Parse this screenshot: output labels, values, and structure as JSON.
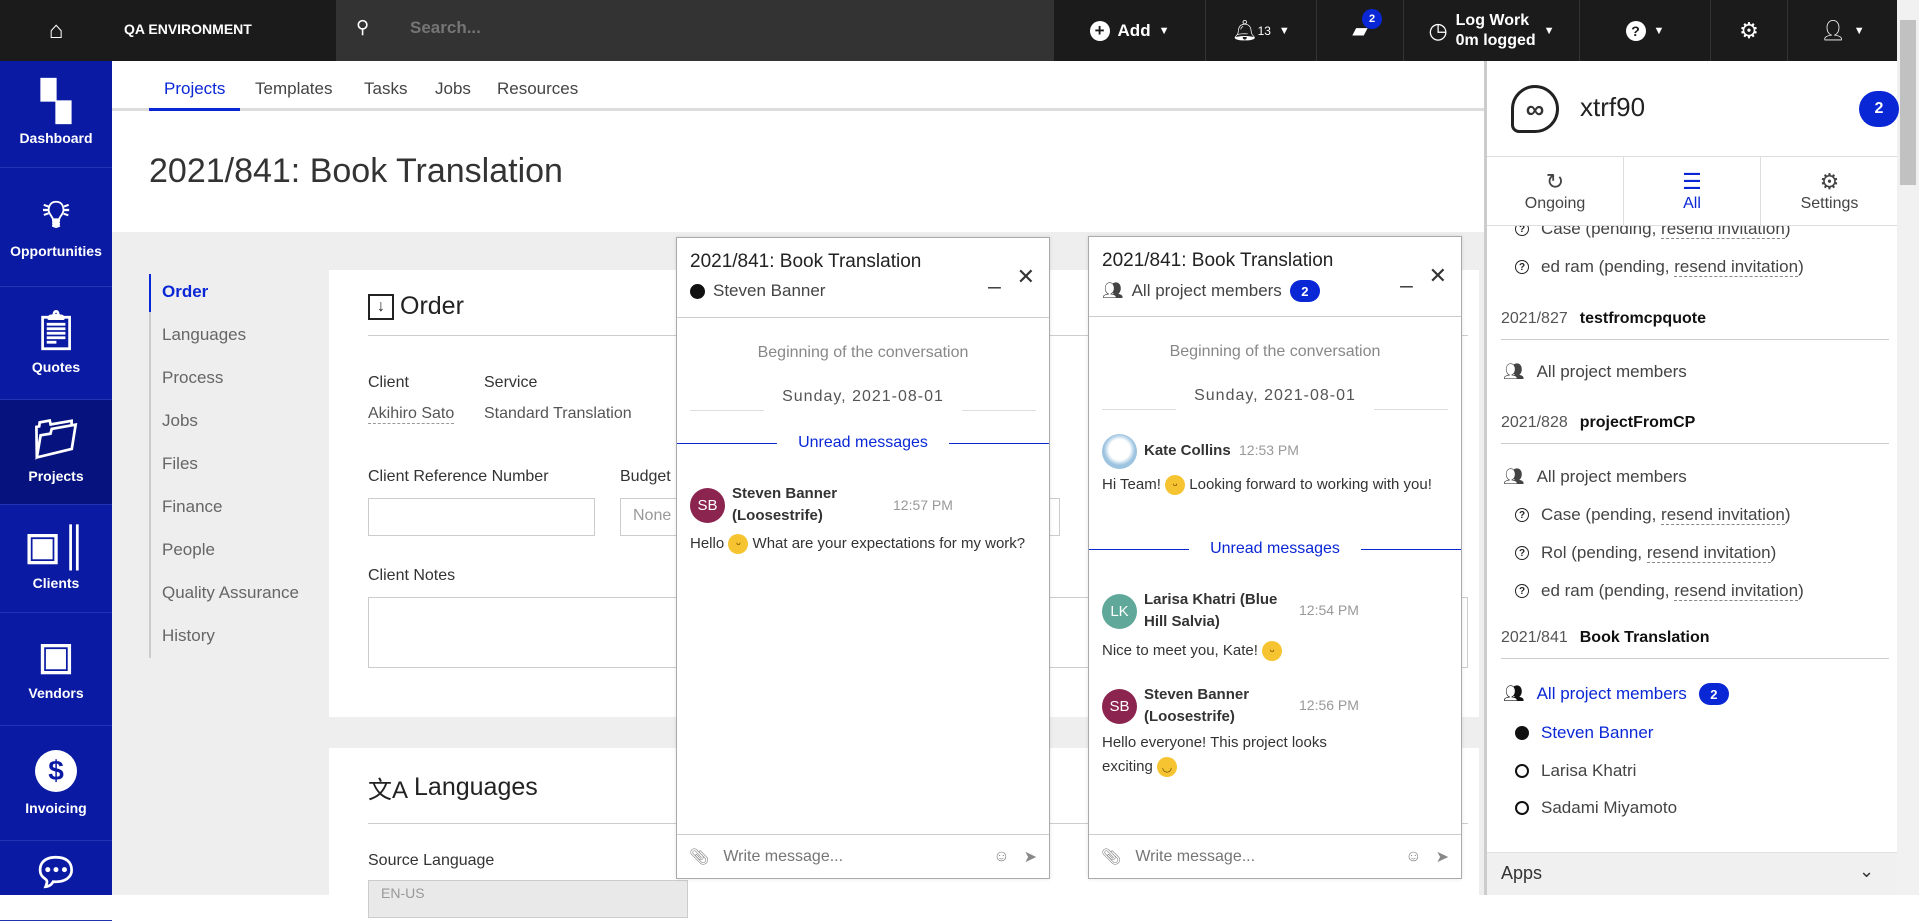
{
  "topbar": {
    "environment": "QA ENVIRONMENT",
    "search_placeholder": "Search...",
    "add_label": "Add",
    "notifications_count": "13",
    "messages_count": "2",
    "log_work_title": "Log Work",
    "log_work_value": "0m logged"
  },
  "sidebar": {
    "items": [
      {
        "label": "Dashboard",
        "icon": "dashboard-icon"
      },
      {
        "label": "Opportunities",
        "icon": "lightbulb-icon"
      },
      {
        "label": "Quotes",
        "icon": "clipboard-icon"
      },
      {
        "label": "Projects",
        "icon": "folder-icon",
        "active": true
      },
      {
        "label": "Clients",
        "icon": "contact-card-icon"
      },
      {
        "label": "Vendors",
        "icon": "person-badge-icon"
      },
      {
        "label": "Invoicing",
        "icon": "dollar-icon"
      },
      {
        "label": "",
        "icon": "chat-icon"
      }
    ]
  },
  "tabs": [
    "Projects",
    "Templates",
    "Tasks",
    "Jobs",
    "Resources"
  ],
  "page_title": "2021/841:  Book Translation",
  "section_nav": [
    "Order",
    "Languages",
    "Process",
    "Jobs",
    "Files",
    "Finance",
    "People",
    "Quality Assurance",
    "History"
  ],
  "order": {
    "title": "Order",
    "client_label": "Client",
    "client_value": "Akihiro Sato",
    "service_label": "Service",
    "service_value": "Standard Translation",
    "client_ref_label": "Client Reference Number",
    "client_ref_value": "",
    "budget_label": "Budget",
    "budget_value": "None",
    "client_notes_label": "Client Notes"
  },
  "languages": {
    "title": "Languages",
    "source_label": "Source Language",
    "source_value": "EN-US"
  },
  "chat1": {
    "title": "2021/841: Book Translation",
    "subtitle": "Steven Banner",
    "beginning": "Beginning of the conversation",
    "date": "Sunday, 2021-08-01",
    "unread": "Unread messages",
    "messages": [
      {
        "initials": "SB",
        "name": "Steven Banner (Loosestrife)",
        "time": "12:57 PM",
        "text_before": "Hello",
        "text_after": "What are your expectations for my work?"
      }
    ],
    "input_placeholder": "Write message..."
  },
  "chat2": {
    "title": "2021/841: Book Translation",
    "subtitle": "All project members",
    "badge": "2",
    "beginning": "Beginning of the conversation",
    "date": "Sunday, 2021-08-01",
    "unread": "Unread messages",
    "messages": [
      {
        "name": "Kate Collins",
        "time": "12:53 PM",
        "text_before": "Hi Team!",
        "text_after": "Looking forward to working with you!"
      },
      {
        "initials": "LK",
        "name": "Larisa Khatri (Blue Hill Salvia)",
        "time": "12:54 PM",
        "text": "Nice to meet you, Kate!"
      },
      {
        "initials": "SB",
        "name": "Steven Banner (Loosestrife)",
        "time": "12:56 PM",
        "text": "Hello everyone! This project looks exciting"
      }
    ],
    "input_placeholder": "Write message..."
  },
  "right_panel": {
    "name": "xtrf90",
    "badge": "2",
    "tabs": [
      "Ongoing",
      "All",
      "Settings"
    ],
    "active_tab": "All",
    "pending_prefix": [
      "Case (pending, ",
      "ed ram (pending, "
    ],
    "resend": "resend invitation",
    "projects": [
      {
        "number": "2021/827",
        "name": "testfromcpquote",
        "channel": "All project members"
      },
      {
        "number": "2021/828",
        "name": "projectFromCP",
        "channel": "All project members",
        "pending": [
          "Case (pending, ",
          "Rol (pending, ",
          "ed ram (pending, "
        ]
      },
      {
        "number": "2021/841",
        "name": "Book Translation",
        "channel": "All project members",
        "badge": "2",
        "members": [
          {
            "name": "Steven Banner",
            "online": true
          },
          {
            "name": "Larisa Khatri",
            "online": false
          },
          {
            "name": "Sadami Miyamoto",
            "online": false
          }
        ]
      }
    ],
    "apps_label": "Apps"
  },
  "colors": {
    "accent": "#0a27d6",
    "sidebar": "#0a1aa3",
    "sidebar_active": "#06137f",
    "topbar": "#1b1b1b",
    "avatar_sb": "#8b2550",
    "avatar_lk": "#5fa89a"
  }
}
